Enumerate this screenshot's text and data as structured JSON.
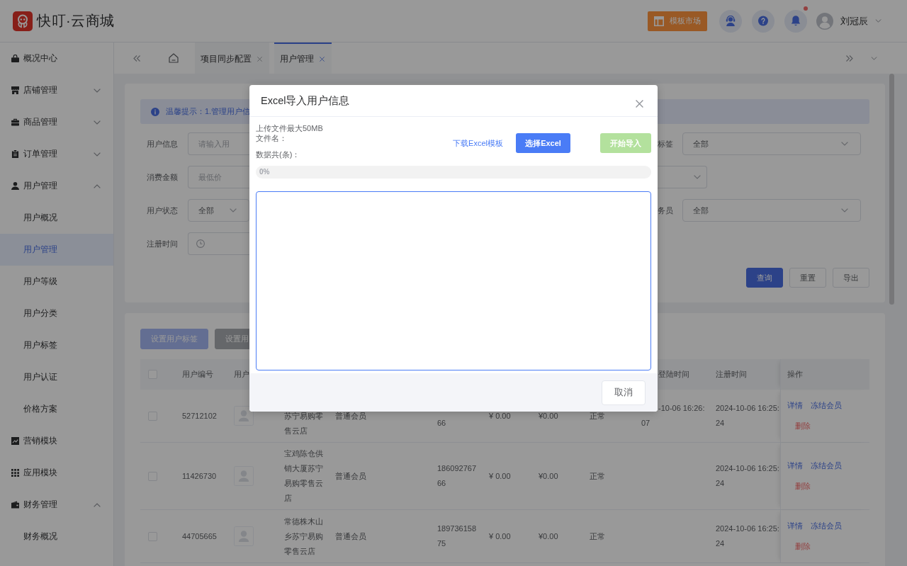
{
  "header": {
    "logo_text": "快叮·云商城",
    "template_button": "模板市场",
    "notifications": {
      "unread": true
    },
    "user_name": "刘冠辰"
  },
  "sidebar": {
    "items": [
      {
        "kind": "link",
        "label": "概况中心",
        "selected": false
      },
      {
        "kind": "group",
        "label": "店铺管理",
        "expanded": false
      },
      {
        "kind": "group",
        "label": "商品管理",
        "expanded": false
      },
      {
        "kind": "group",
        "label": "订单管理",
        "expanded": false
      },
      {
        "kind": "group",
        "label": "用户管理",
        "expanded": true,
        "children": [
          {
            "label": "用户概况",
            "selected": false
          },
          {
            "label": "用户管理",
            "selected": true
          },
          {
            "label": "用户等级",
            "selected": false
          },
          {
            "label": "用户分类",
            "selected": false
          },
          {
            "label": "用户标签",
            "selected": false
          },
          {
            "label": "用户认证",
            "selected": false
          },
          {
            "label": "价格方案",
            "selected": false
          }
        ]
      },
      {
        "kind": "link",
        "label": "营销模块",
        "selected": false
      },
      {
        "kind": "link",
        "label": "应用模块",
        "selected": false
      },
      {
        "kind": "group",
        "label": "财务管理",
        "expanded": true,
        "children": [
          {
            "label": "财务概况",
            "selected": false
          }
        ]
      }
    ]
  },
  "tab_bar": {
    "tabs": [
      {
        "label": "项目同步配置",
        "selected": false
      },
      {
        "label": "用户管理",
        "selected": true
      }
    ]
  },
  "filter_panel": {
    "notice": "温馨提示：1.管理用户信",
    "left_filters": [
      {
        "kind": "input",
        "label": "用户信息",
        "placeholder": "请输入用"
      },
      {
        "kind": "input",
        "label": "消费金额",
        "placeholder": "最低价"
      },
      {
        "kind": "select",
        "label": "用户状态",
        "value": "全部"
      },
      {
        "kind": "date",
        "label": "注册时间"
      }
    ],
    "right_filters": [
      {
        "kind": "select",
        "label": "标签",
        "value": "全部"
      },
      {
        "kind": "narrow"
      },
      {
        "kind": "select",
        "label": "务员",
        "value": "全部"
      }
    ],
    "buttons": [
      {
        "label": "查询",
        "kind": "primary"
      },
      {
        "label": "重置",
        "kind": "default"
      },
      {
        "label": "导出",
        "kind": "default"
      }
    ]
  },
  "user_table": {
    "toolbar": [
      {
        "label": "设置用户标签",
        "kind": "primary",
        "disabled": true
      },
      {
        "label": "设置用",
        "kind": "info",
        "disabled": true
      }
    ],
    "header": {
      "select_all": {
        "checked": false
      },
      "user_id": "用户编号",
      "column_3": "用户",
      "column_10": "登陆时间",
      "register_time": "注册时间",
      "actions": "操作"
    },
    "rows": [
      {
        "checked": false,
        "user_id": "52712102",
        "column_4": "苏宁易购零售云店",
        "column_5": "普通会员",
        "column_6": "66",
        "column_7": "¥ 0.00",
        "column_8": "¥0.00",
        "column_9": "正常",
        "column_10": "-10-06 16:26:07",
        "register_time": "2024-10-06 16:25:24",
        "actions": [
          {
            "label": "详情",
            "kind": "link"
          },
          {
            "label": "冻结会员",
            "kind": "link"
          },
          {
            "label": "删除",
            "kind": "danger"
          }
        ]
      },
      {
        "checked": false,
        "user_id": "11426730",
        "column_4": "宝鸡陈仓供销大厦苏宁易购零售云店",
        "column_5": "普通会员",
        "column_6": "18609276766",
        "column_7": "¥ 0.00",
        "column_8": "¥0.00",
        "column_9": "正常",
        "register_time": "2024-10-06 16:25:24",
        "actions": [
          {
            "label": "详情",
            "kind": "link"
          },
          {
            "label": "冻结会员",
            "kind": "link"
          },
          {
            "label": "删除",
            "kind": "danger"
          }
        ]
      },
      {
        "checked": false,
        "user_id": "44705665",
        "column_4": "常德株木山乡苏宁易购零售云店",
        "column_5": "普通会员",
        "column_6": "18973615875",
        "column_7": "¥ 0.00",
        "column_8": "¥0.00",
        "column_9": "正常",
        "register_time": "2024-10-06 16:25:24",
        "actions": [
          {
            "label": "详情",
            "kind": "link"
          },
          {
            "label": "冻结会员",
            "kind": "link"
          },
          {
            "label": "删除",
            "kind": "danger"
          }
        ]
      }
    ]
  },
  "dialog": {
    "title": "Excel导入用户信息",
    "size_note": "上传文件最大50MB",
    "file_name_label": "文件名：",
    "count_label": "数据共(条)：",
    "template_link": "下载Excel模板",
    "select_button": {
      "label": "选择Excel",
      "disabled": false
    },
    "import_button": {
      "label": "开始导入",
      "disabled": true
    },
    "progress": {
      "level": 0,
      "reading": "0%"
    },
    "result_area": {
      "focused": true
    },
    "cancel_button": "取消"
  }
}
